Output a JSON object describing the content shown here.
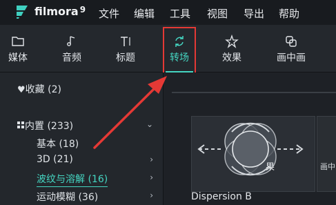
{
  "app": {
    "name": "filmora",
    "version": "9"
  },
  "menu": [
    "文件",
    "编辑",
    "工具",
    "视图",
    "导出",
    "帮助"
  ],
  "toolbar": {
    "items": [
      {
        "label": "媒体",
        "icon": "folder-icon"
      },
      {
        "label": "音频",
        "icon": "music-note-icon"
      },
      {
        "label": "标题",
        "icon": "text-title-icon"
      },
      {
        "label": "转场",
        "icon": "transition-icon",
        "active": true
      },
      {
        "label": "效果",
        "icon": "effects-icon"
      },
      {
        "label": "画中画",
        "icon": "pip-icon"
      }
    ]
  },
  "sidebar": {
    "favorites": "收藏 (2)",
    "builtin": "内置 (233)",
    "items": [
      {
        "label": "基本 (18)"
      },
      {
        "label": "3D (21)",
        "chevron": true
      },
      {
        "label": "波纹与溶解 (16)",
        "chevron": true,
        "active": true
      },
      {
        "label": "运动模糊 (36)",
        "chevron": true
      }
    ]
  },
  "content": {
    "thumbnail_title": "Dispersion B",
    "thumbnail_overlay_text": "果",
    "thumbnail2_text": "画中画"
  },
  "colors": {
    "accent": "#45d6c2",
    "highlight": "#e53935",
    "background": "#1f2328"
  }
}
